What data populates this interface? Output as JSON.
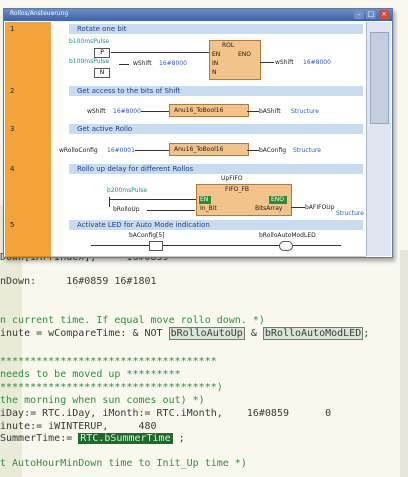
{
  "window": {
    "title": "Rollos/Ansteuerung"
  },
  "networks": [
    {
      "num": "1",
      "comment": "Rotate one bit"
    },
    {
      "num": "2",
      "comment": "Get access to the bits of Shift"
    },
    {
      "num": "3",
      "comment": "Get active Rollo"
    },
    {
      "num": "4",
      "comment": "Rollo up delay for different Rollos"
    },
    {
      "num": "5",
      "comment": "Activate LED for Auto Mode indication"
    }
  ],
  "n1": {
    "pulse1": "b100msPulse",
    "p": "P",
    "pulse2": "b100msPulse",
    "n": "N",
    "var": "wShift",
    "val": "16#8000",
    "block": "ROL",
    "en": "EN",
    "eno": "ENO",
    "in": "IN",
    "nn": "N",
    "out": "wShift",
    "outval": "16#8000"
  },
  "n2": {
    "in": "wShift",
    "inval": "16#8000",
    "block": "Anu16_ToBool16",
    "out": "bAShift",
    "outval": "Structure"
  },
  "n3": {
    "in": "wRolloConfig",
    "inval": "16#0001",
    "block": "Anu16_ToBool16",
    "out": "bAConfig",
    "outval": "Structure"
  },
  "n4": {
    "pulse": "b200msPulse",
    "block": "UpFIFO",
    "fbname": "FIFO_FB",
    "en": "EN",
    "eno": "ENO",
    "inb": "In_Bit",
    "bits": "BitsArray",
    "roll": "bRolloUp",
    "out": "bAFIFOUp",
    "outval": "Structure"
  },
  "n5": {
    "in": "bAConfig[5]",
    "out": "bRolloAutoModLED"
  },
  "code": [
    {
      "text": "Down[iArrIndex];     16#0859"
    },
    {
      "text": "nDown:     16#0859 16#1801"
    },
    {
      "text": "n current time. If equal move rollo down. *)"
    },
    {
      "text": "inute = wCompareTime: & NOT ",
      "hl": "bRolloAutoUp",
      "mid": " & ",
      "hl2": "bRolloAutoModLED",
      "tail": ";"
    },
    {
      "text": "************************************"
    },
    {
      "text": "needs to be moved up *********"
    },
    {
      "text": "************************************)"
    },
    {
      "text": "the morning when sun comes out) *)"
    },
    {
      "text": "iDay:= RTC.iDay, iMonth:= RTC.iMonth,    16#0859      0"
    },
    {
      "text": "inute:= iWINTERUP,     480"
    },
    {
      "text": "SummerTime:= ",
      "sel": "RTC.bSummerTime",
      "tail": " ;"
    },
    {
      "text": ""
    },
    {
      "text": "t AutoHourMinDown time to Init_Up time *)"
    }
  ]
}
